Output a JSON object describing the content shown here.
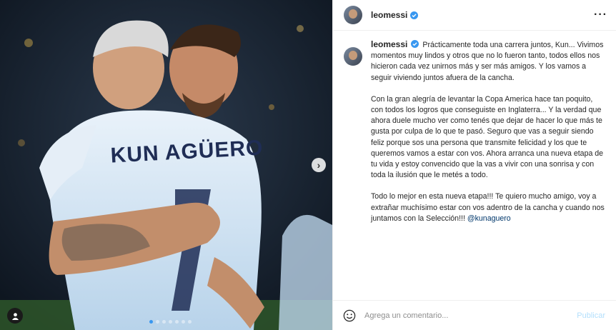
{
  "post": {
    "username": "leomessi",
    "caption_username": "leomessi",
    "jersey_text": "KUN AGÜERO",
    "paragraphs": [
      "Prácticamente toda una carrera juntos, Kun... Vivimos momentos muy lindos y otros que no lo fueron tanto, todos ellos nos hicieron cada vez unirnos más y ser más amigos. Y los vamos a seguir viviendo juntos afuera de la cancha.",
      "Con la gran alegría de levantar la Copa America hace tan poquito, con todos los logros que conseguiste en Inglaterra... Y la verdad que ahora duele mucho ver como tenés que dejar de hacer lo que más te gusta por culpa de lo que te pasó. Seguro que vas a seguir siendo feliz porque sos una persona que transmite felicidad y los que te queremos vamos a estar con vos. Ahora arranca una nueva etapa de tu vida y estoy convencido que la vas a vivir con una sonrisa y con toda la ilusión que le metés a todo.",
      "Todo lo mejor en esta nueva etapa!!! Te quiero mucho amigo, voy a extrañar muchísimo estar con vos adentro de la cancha y cuando nos juntamos con la Selección!!!"
    ],
    "mention": "@kunaguero"
  },
  "footer": {
    "comment_placeholder": "Agrega un comentario...",
    "post_label": "Publicar"
  },
  "carousel": {
    "count": 7,
    "active_index": 0
  },
  "colors": {
    "verified": "#3897f0",
    "mention": "#00376b",
    "post_disabled": "#b2dffc"
  },
  "icons": [
    "chevron-right-icon",
    "user-tag-icon",
    "verified-icon",
    "more-icon",
    "emoji-icon"
  ]
}
